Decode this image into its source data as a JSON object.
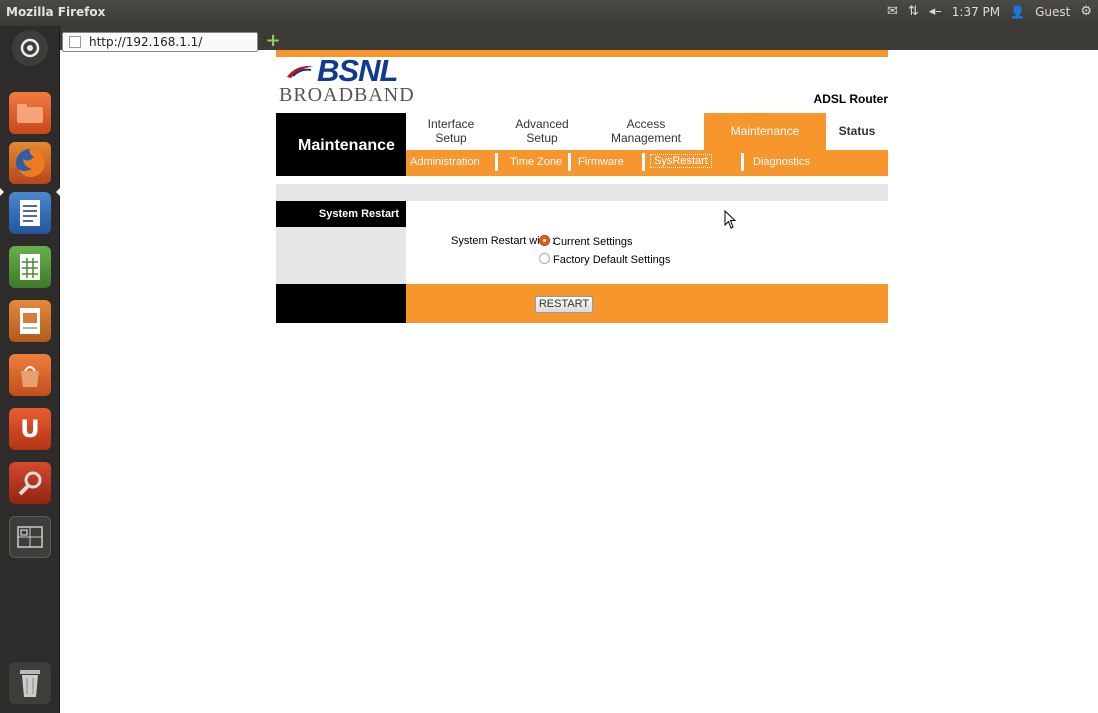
{
  "window": {
    "title": "Mozilla Firefox"
  },
  "panel": {
    "time": "1:37 PM",
    "user": "Guest"
  },
  "browser": {
    "url": "http://192.168.1.1/"
  },
  "router": {
    "brand": "BSNL",
    "sub_brand": "BROADBAND",
    "model": "ADSL Router",
    "section_title": "Maintenance",
    "tabs": [
      {
        "line1": "Interface",
        "line2": "Setup"
      },
      {
        "line1": "Advanced",
        "line2": "Setup"
      },
      {
        "line1": "Access",
        "line2": "Management"
      },
      {
        "line1": "Maintenance",
        "line2": ""
      },
      {
        "line1": "Status",
        "line2": ""
      }
    ],
    "subtabs": [
      "Administration",
      "Time Zone",
      "Firmware",
      "SysRestart",
      "Diagnostics"
    ],
    "panel_title": "System Restart",
    "form_label": "System Restart with :",
    "options": [
      "Current Settings",
      "Factory Default Settings"
    ],
    "selected_option": "Current Settings",
    "button": "RESTART"
  },
  "colors": {
    "accent": "#f7962d",
    "brand": "#0f3a8f"
  }
}
